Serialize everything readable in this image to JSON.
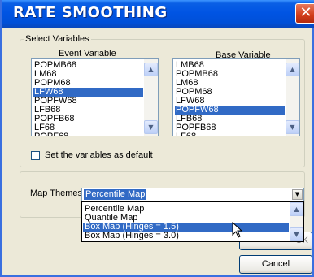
{
  "window": {
    "title": "RATE SMOOTHING",
    "close_glyph": "✕"
  },
  "select_variables": {
    "legend": "Select Variables",
    "event": {
      "header": "Event Variable",
      "items": [
        "POPMB68",
        "LM68",
        "POPM68",
        "LFW68",
        "POPFW68",
        "LFB68",
        "POPFB68",
        "LF68",
        "POPF68"
      ],
      "selected": "LFW68"
    },
    "base": {
      "header": "Base Variable",
      "items": [
        "LMB68",
        "POPMB68",
        "LM68",
        "POPM68",
        "LFW68",
        "POPFW68",
        "LFB68",
        "POPFB68",
        "LF68"
      ],
      "selected": "POPFW68"
    },
    "default_checkbox": {
      "label": "Set the variables as default",
      "checked": false
    }
  },
  "map_themes": {
    "label": "Map Themes",
    "selected": "Percentile Map",
    "options": [
      "Percentile Map",
      "Quantile Map",
      "Box Map (Hinges = 1.5)",
      "Box Map (Hinges = 3.0)"
    ],
    "highlighted": "Box Map (Hinges = 1.5)"
  },
  "buttons": {
    "ok_partial": "OK",
    "cancel": "Cancel"
  },
  "icons": {
    "scroll_up": "up-arrow-icon",
    "scroll_down": "down-arrow-icon",
    "dropdown": "chevron-down-icon",
    "cursor": "mouse-pointer-icon"
  },
  "colors": {
    "title_bar": "#0054e3",
    "selection": "#316ac5",
    "dialog_bg": "#ece9d8",
    "close": "#d13c1a"
  }
}
